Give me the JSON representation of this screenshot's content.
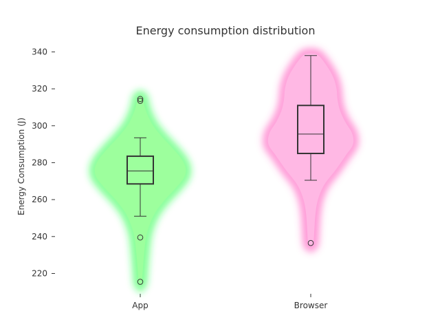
{
  "chart_data": {
    "type": "violin",
    "title": "Energy consumption distribution",
    "xlabel": "",
    "ylabel": "Energy Consumption (J)",
    "categories": [
      "App",
      "Browser"
    ],
    "ylim": [
      209,
      345
    ],
    "yticks": [
      220,
      240,
      260,
      280,
      300,
      320,
      340
    ],
    "grid": false,
    "series": [
      {
        "category": "App",
        "color": "#22ff44",
        "fill": "#9dff9d",
        "box": {
          "whisker_low": 251,
          "q1": 268.5,
          "median": 275.5,
          "q3": 283.5,
          "whisker_high": 293.5
        },
        "outliers": [
          215.5,
          239.5,
          313.5,
          314.5
        ],
        "density": [
          [
            215,
            0.03
          ],
          [
            222,
            0.05
          ],
          [
            232,
            0.08
          ],
          [
            242,
            0.13
          ],
          [
            252,
            0.27
          ],
          [
            260,
            0.48
          ],
          [
            266,
            0.68
          ],
          [
            272,
            0.85
          ],
          [
            277,
            0.88
          ],
          [
            282,
            0.8
          ],
          [
            288,
            0.62
          ],
          [
            294,
            0.42
          ],
          [
            300,
            0.25
          ],
          [
            306,
            0.14
          ],
          [
            311,
            0.08
          ],
          [
            315,
            0.05
          ]
        ]
      },
      {
        "category": "Browser",
        "color": "#ff4db8",
        "fill": "#ffb8e4",
        "box": {
          "whisker_low": 270.5,
          "q1": 285,
          "median": 295.5,
          "q3": 311,
          "whisker_high": 338
        },
        "outliers": [
          236.5
        ],
        "density": [
          [
            236,
            0.05
          ],
          [
            244,
            0.07
          ],
          [
            252,
            0.09
          ],
          [
            260,
            0.14
          ],
          [
            268,
            0.26
          ],
          [
            276,
            0.48
          ],
          [
            284,
            0.68
          ],
          [
            290,
            0.82
          ],
          [
            296,
            0.8
          ],
          [
            302,
            0.67
          ],
          [
            308,
            0.57
          ],
          [
            314,
            0.52
          ],
          [
            320,
            0.5
          ],
          [
            326,
            0.44
          ],
          [
            332,
            0.32
          ],
          [
            338,
            0.15
          ]
        ]
      }
    ]
  }
}
